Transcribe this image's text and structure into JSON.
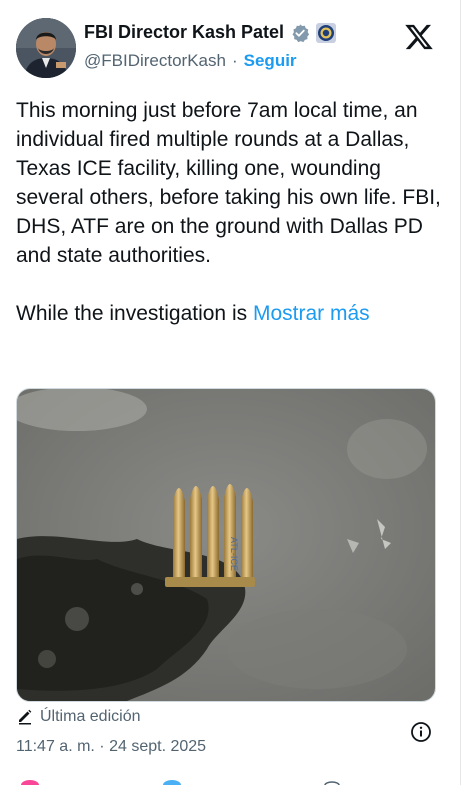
{
  "author": {
    "name": "FBI Director Kash Patel",
    "handle": "@FBIDirectorKash",
    "separator": "·",
    "follow_label": "Seguir"
  },
  "tweet": {
    "text": "This morning just before 7am local time, an individual fired multiple rounds at a Dallas, Texas ICE facility, killing one, wounding several others, before taking his own life. FBI, DHS, ATF are on the ground with Dallas PD and state authorities.\n\nWhile the investigation is ",
    "show_more": "Mostrar más"
  },
  "media": {
    "cartridge_stamp": "ATL-ICE"
  },
  "meta": {
    "edited_label": "Última edición",
    "timestamp": "11:47 a. m. · 24 sept. 2025"
  },
  "icons": {
    "verified": "verified-badge-icon",
    "agency_seal": "fbi-seal-icon",
    "brand": "x-logo-icon",
    "edit": "pencil-icon",
    "info": "info-icon"
  },
  "colors": {
    "accent": "#1d9bf0",
    "text": "#0f1419",
    "secondary": "#536471",
    "verified_gray": "#829aab"
  }
}
